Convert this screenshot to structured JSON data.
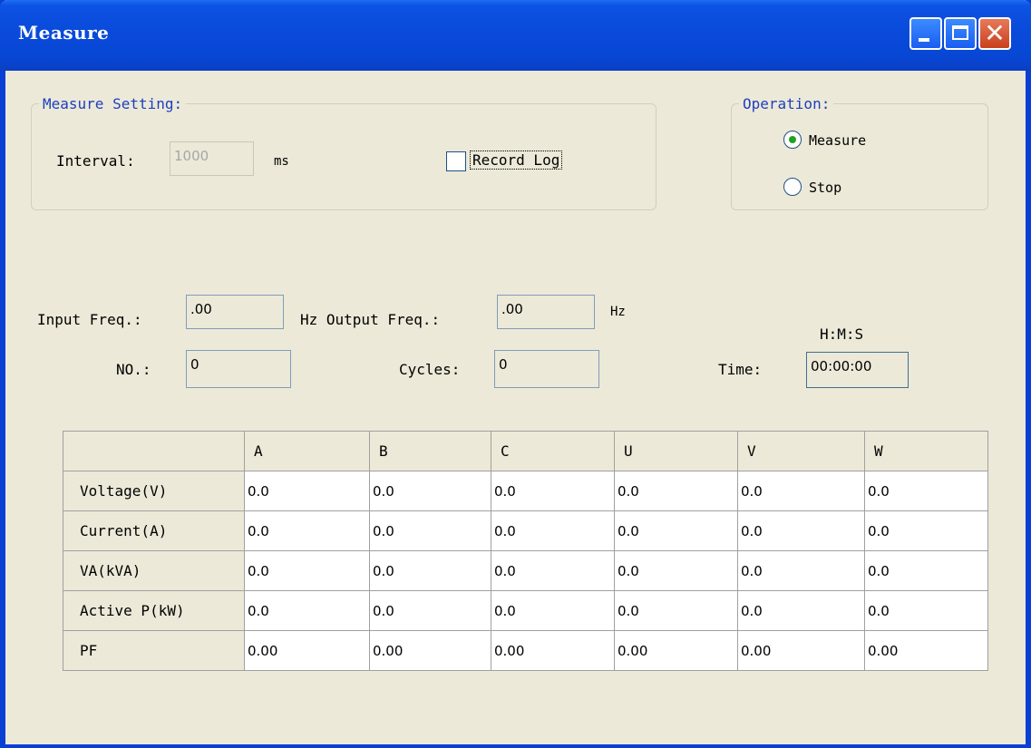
{
  "window": {
    "title": "Measure",
    "buttons": {
      "minimize": "minimize-icon",
      "maximize": "maximize-icon",
      "close": "close-icon"
    }
  },
  "measure_setting": {
    "legend": "Measure Setting:",
    "interval_label": "Interval:",
    "interval_value": "1000",
    "interval_unit": "ms",
    "record_log_label": "Record Log",
    "record_log_checked": false
  },
  "operation": {
    "legend": "Operation:",
    "options": [
      {
        "label": "Measure",
        "selected": true
      },
      {
        "label": "Stop",
        "selected": false
      }
    ]
  },
  "readouts": {
    "input_freq_label": "Input Freq.:",
    "input_freq_value": ".00",
    "output_freq_label": "Hz Output Freq.:",
    "output_freq_value": ".00",
    "output_freq_unit": "Hz",
    "hms_label": "H:M:S",
    "no_label": "NO.:",
    "no_value": "0",
    "cycles_label": "Cycles:",
    "cycles_value": "0",
    "time_label": "Time:",
    "time_value": "00:00:00"
  },
  "table": {
    "columns": [
      "",
      "A",
      "B",
      "C",
      "U",
      "V",
      "W"
    ],
    "rows": [
      {
        "label": "Voltage(V)",
        "values": [
          "0.0",
          "0.0",
          "0.0",
          "0.0",
          "0.0",
          "0.0"
        ]
      },
      {
        "label": "Current(A)",
        "values": [
          "0.0",
          "0.0",
          "0.0",
          "0.0",
          "0.0",
          "0.0"
        ]
      },
      {
        "label": "VA(kVA)",
        "values": [
          "0.0",
          "0.0",
          "0.0",
          "0.0",
          "0.0",
          "0.0"
        ]
      },
      {
        "label": "Active P(kW)",
        "values": [
          "0.0",
          "0.0",
          "0.0",
          "0.0",
          "0.0",
          "0.0"
        ]
      },
      {
        "label": "PF",
        "values": [
          "0.00",
          "0.00",
          "0.00",
          "0.00",
          "0.00",
          "0.00"
        ]
      }
    ]
  }
}
